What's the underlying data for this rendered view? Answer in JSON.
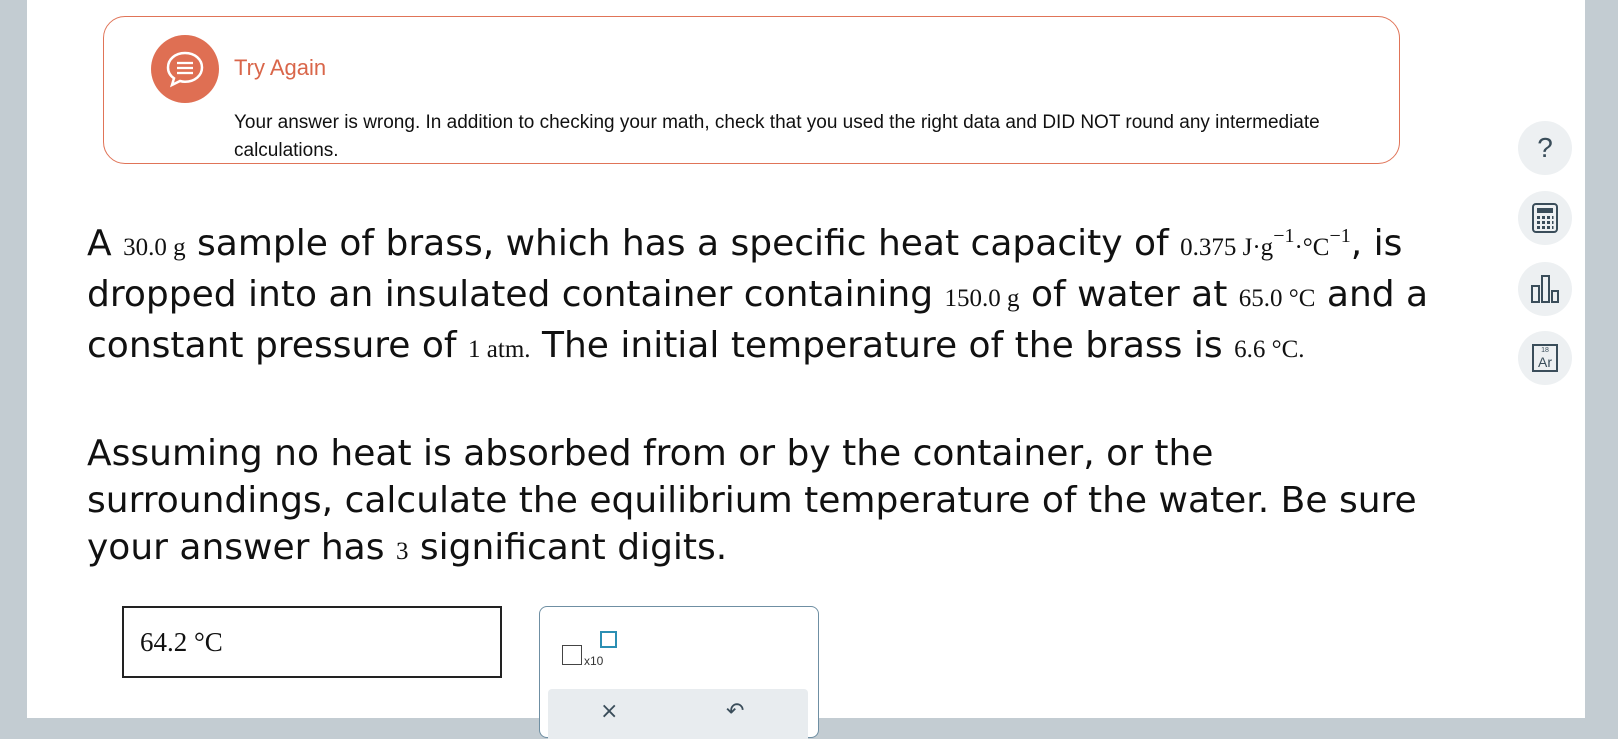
{
  "alert": {
    "title": "Try Again",
    "message": "Your answer is wrong. In addition to checking your math, check that you used the right data and DID NOT round any intermediate calculations.",
    "icon": "chat-bubble-icon",
    "color": "#df6f53"
  },
  "question": {
    "p1": {
      "t1": "A ",
      "mass_brass": "30.0 g",
      "t2": " sample of brass, which has a specific heat capacity of ",
      "cp_value": "0.375 J·g",
      "cp_exp1": "−1",
      "cp_mid": "·°C",
      "cp_exp2": "−1",
      "t3": ", is dropped into an insulated container containing ",
      "mass_water": "150.0 g",
      "t4": " of water at ",
      "temp_water": "65.0 °C",
      "t5": " and a constant pressure of ",
      "pressure": "1 atm.",
      "t6": " The initial temperature of the brass is ",
      "temp_brass": "6.6 °C."
    },
    "p2": {
      "t1": "Assuming no heat is absorbed from or by the container, or the surroundings, calculate the equilibrium temperature of the water. Be sure your answer has ",
      "sig_digits": "3",
      "t2": " significant digits."
    }
  },
  "answer": {
    "value": "64.2 °C"
  },
  "tools": {
    "sci_label": "x10",
    "clear_icon": "×",
    "undo_icon": "↶"
  },
  "sidebar": {
    "help_glyph": "?",
    "periodic_number": "18",
    "periodic_symbol": "Ar"
  }
}
